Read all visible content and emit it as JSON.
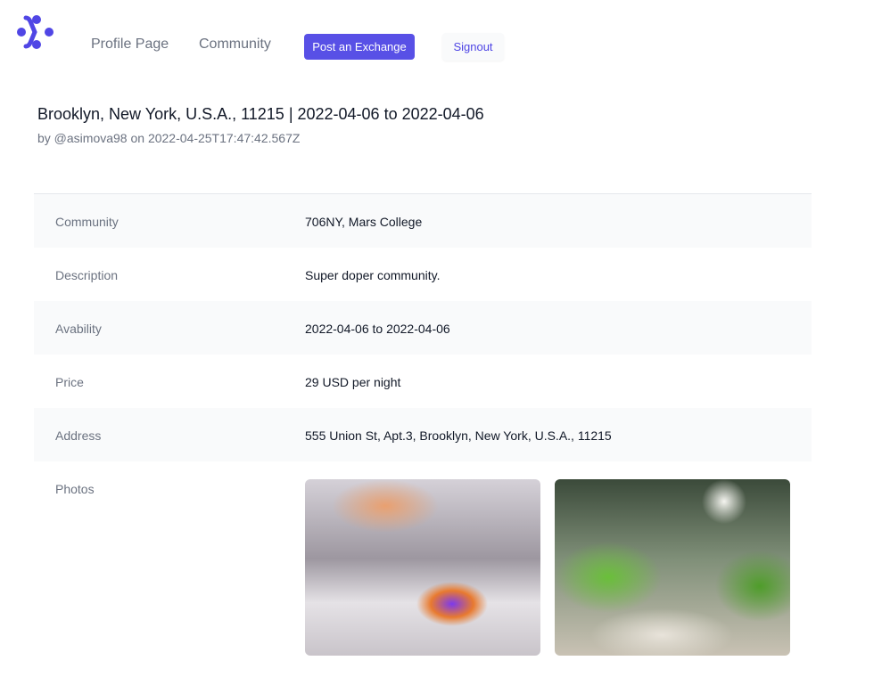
{
  "nav": {
    "profile": "Profile Page",
    "community": "Community",
    "post": "Post an Exchange",
    "signout": "Signout"
  },
  "header": {
    "title": "Brooklyn, New York, U.S.A., 11215 | 2022-04-06 to 2022-04-06",
    "byline": "by @asimova98 on 2022-04-25T17:47:42.567Z"
  },
  "details": [
    {
      "label": "Community",
      "value": "706NY, Mars College"
    },
    {
      "label": "Description",
      "value": "Super doper community."
    },
    {
      "label": "Avability",
      "value": "2022-04-06 to 2022-04-06"
    },
    {
      "label": "Price",
      "value": "29 USD per night"
    },
    {
      "label": "Address",
      "value": "555 Union St, Apt.3, Brooklyn, New York, U.S.A., 11215"
    }
  ],
  "photos_label": "Photos",
  "colors": {
    "accent": "#5850e6"
  }
}
